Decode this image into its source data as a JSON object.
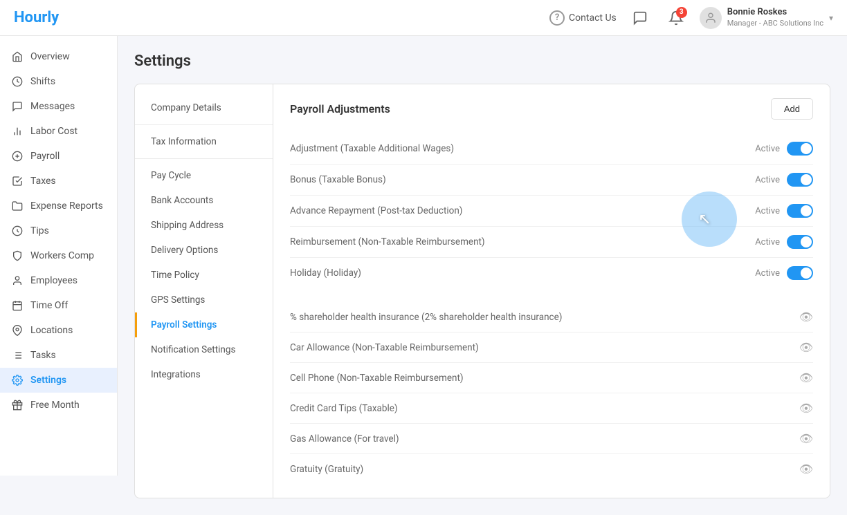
{
  "app": {
    "logo": "Hourly",
    "topnav": {
      "contact_label": "Contact Us",
      "notification_count": "3",
      "user_name": "Bonnie Roskes",
      "user_role": "Manager - ABC Solutions Inc"
    }
  },
  "sidebar": {
    "items": [
      {
        "id": "overview",
        "label": "Overview",
        "icon": "home"
      },
      {
        "id": "shifts",
        "label": "Shifts",
        "icon": "clock"
      },
      {
        "id": "messages",
        "label": "Messages",
        "icon": "message"
      },
      {
        "id": "labor-cost",
        "label": "Labor Cost",
        "icon": "bar-chart"
      },
      {
        "id": "payroll",
        "label": "Payroll",
        "icon": "dollar"
      },
      {
        "id": "taxes",
        "label": "Taxes",
        "icon": "receipt"
      },
      {
        "id": "expense-reports",
        "label": "Expense Reports",
        "icon": "folder"
      },
      {
        "id": "tips",
        "label": "Tips",
        "icon": "coin"
      },
      {
        "id": "workers-comp",
        "label": "Workers Comp",
        "icon": "shield"
      },
      {
        "id": "employees",
        "label": "Employees",
        "icon": "person"
      },
      {
        "id": "time-off",
        "label": "Time Off",
        "icon": "calendar"
      },
      {
        "id": "locations",
        "label": "Locations",
        "icon": "pin"
      },
      {
        "id": "tasks",
        "label": "Tasks",
        "icon": "list"
      },
      {
        "id": "settings",
        "label": "Settings",
        "icon": "gear",
        "active": true
      },
      {
        "id": "free-month",
        "label": "Free Month",
        "icon": "gift"
      }
    ]
  },
  "settings": {
    "page_title": "Settings",
    "nav_items": [
      {
        "id": "company-details",
        "label": "Company Details"
      },
      {
        "id": "tax-information",
        "label": "Tax Information"
      },
      {
        "id": "pay-cycle",
        "label": "Pay Cycle"
      },
      {
        "id": "bank-accounts",
        "label": "Bank Accounts"
      },
      {
        "id": "shipping-address",
        "label": "Shipping Address"
      },
      {
        "id": "delivery-options",
        "label": "Delivery Options"
      },
      {
        "id": "time-policy",
        "label": "Time Policy"
      },
      {
        "id": "gps-settings",
        "label": "GPS Settings"
      },
      {
        "id": "payroll-settings",
        "label": "Payroll Settings",
        "active": true
      },
      {
        "id": "notification-settings",
        "label": "Notification Settings"
      },
      {
        "id": "integrations",
        "label": "Integrations"
      }
    ],
    "payroll_adjustments": {
      "section_title": "Payroll Adjustments",
      "add_button": "Add",
      "active_items": [
        {
          "id": "adj-1",
          "name": "Adjustment (Taxable Additional Wages)",
          "status": "Active",
          "enabled": true
        },
        {
          "id": "adj-2",
          "name": "Bonus (Taxable Bonus)",
          "status": "Active",
          "enabled": true
        },
        {
          "id": "adj-3",
          "name": "Advance Repayment (Post-tax Deduction)",
          "status": "Active",
          "enabled": true
        },
        {
          "id": "adj-4",
          "name": "Reimbursement (Non-Taxable Reimbursement)",
          "status": "Active",
          "enabled": true
        },
        {
          "id": "adj-5",
          "name": "Holiday (Holiday)",
          "status": "Active",
          "enabled": true
        }
      ],
      "inactive_items": [
        {
          "id": "inact-1",
          "name": "% shareholder health insurance (2% shareholder health insurance)"
        },
        {
          "id": "inact-2",
          "name": "Car Allowance (Non-Taxable Reimbursement)"
        },
        {
          "id": "inact-3",
          "name": "Cell Phone (Non-Taxable Reimbursement)"
        },
        {
          "id": "inact-4",
          "name": "Credit Card Tips (Taxable)"
        },
        {
          "id": "inact-5",
          "name": "Gas Allowance (For travel)"
        },
        {
          "id": "inact-6",
          "name": "Gratuity (Gratuity)"
        }
      ]
    }
  }
}
